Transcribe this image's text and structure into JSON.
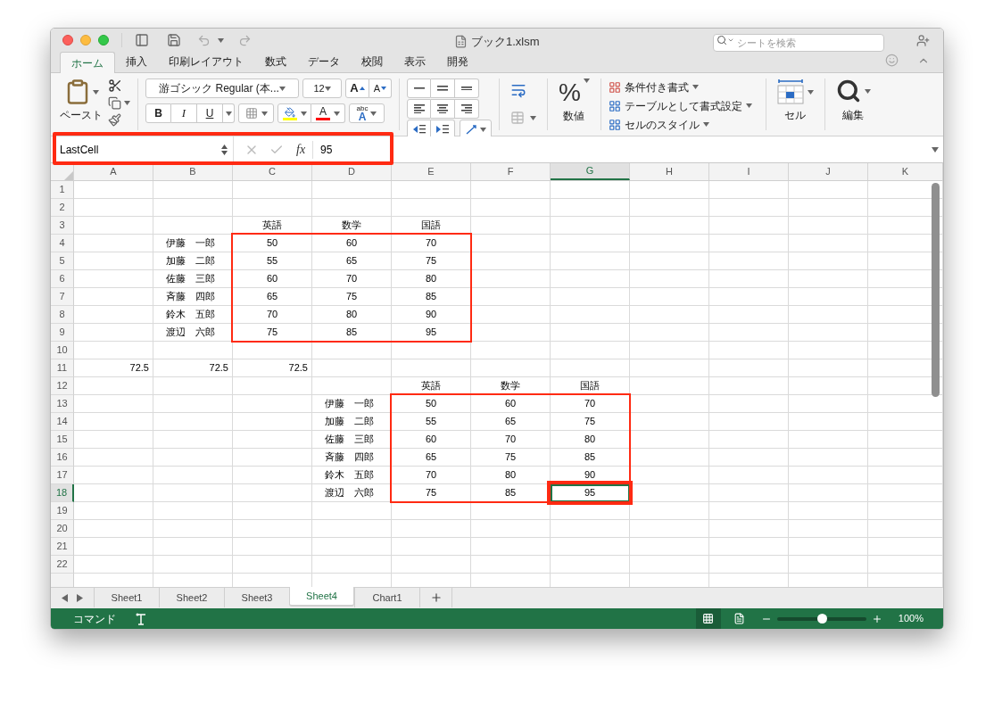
{
  "window": {
    "title": "ブック1.xlsm",
    "search_placeholder": "シートを検索"
  },
  "ribbon_tabs": [
    {
      "label": "ホーム",
      "selected": true
    },
    {
      "label": "挿入",
      "selected": false
    },
    {
      "label": "印刷レイアウト",
      "selected": false
    },
    {
      "label": "数式",
      "selected": false
    },
    {
      "label": "データ",
      "selected": false
    },
    {
      "label": "校閲",
      "selected": false
    },
    {
      "label": "表示",
      "selected": false
    },
    {
      "label": "開発",
      "selected": false
    }
  ],
  "ribbon": {
    "paste_label": "ペースト",
    "font_name": "游ゴシック Regular (本...",
    "font_size": "12",
    "grow_label": "A",
    "shrink_label": "A",
    "bold_label": "B",
    "italic_label": "I",
    "underline_label": "U",
    "font_color_label": "A",
    "wrap_small_label": "abc",
    "wrap_big_label": "A",
    "number_symbol": "%",
    "number_label": "数値",
    "style_items": [
      "条件付き書式",
      "テーブルとして書式設定",
      "セルのスタイル"
    ],
    "cells_label": "セル",
    "editing_label": "編集"
  },
  "formula_bar": {
    "name_box": "LastCell",
    "fx": "fx",
    "value": "95",
    "highlighted": true
  },
  "columns": [
    {
      "label": "A",
      "selected": false
    },
    {
      "label": "B",
      "selected": false
    },
    {
      "label": "C",
      "selected": false
    },
    {
      "label": "D",
      "selected": false
    },
    {
      "label": "E",
      "selected": false
    },
    {
      "label": "F",
      "selected": false
    },
    {
      "label": "G",
      "selected": true
    },
    {
      "label": "H",
      "selected": false
    },
    {
      "label": "I",
      "selected": false
    },
    {
      "label": "J",
      "selected": false
    },
    {
      "label": "K",
      "selected": false
    }
  ],
  "rows": [
    {
      "number": "1",
      "selected": false
    },
    {
      "number": "2",
      "selected": false
    },
    {
      "number": "3",
      "selected": false,
      "cells": [
        null,
        null,
        {
          "text": "英語",
          "kind": "center",
          "framed": false,
          "emphasized": false
        },
        {
          "text": "数学",
          "kind": "center",
          "framed": false,
          "emphasized": false
        },
        {
          "text": "国語",
          "kind": "center",
          "framed": false,
          "emphasized": false
        }
      ]
    },
    {
      "number": "4",
      "selected": false,
      "cells": [
        null,
        {
          "text": "伊藤　一郎",
          "kind": "label",
          "framed": false,
          "emphasized": false
        },
        {
          "text": "50",
          "kind": "center",
          "framed": true,
          "emphasized": false
        },
        {
          "text": "60",
          "kind": "center",
          "framed": true,
          "emphasized": false
        },
        {
          "text": "70",
          "kind": "center",
          "framed": true,
          "emphasized": false
        }
      ]
    },
    {
      "number": "5",
      "selected": false,
      "cells": [
        null,
        {
          "text": "加藤　二郎",
          "kind": "label",
          "framed": false,
          "emphasized": false
        },
        {
          "text": "55",
          "kind": "center",
          "framed": true,
          "emphasized": false
        },
        {
          "text": "65",
          "kind": "center",
          "emphasized": false
        },
        {
          "text": "75",
          "kind": "center",
          "framed": true,
          "emphasized": false
        }
      ]
    },
    {
      "number": "6",
      "selected": false,
      "cells": [
        null,
        {
          "text": "佐藤　三郎",
          "kind": "label",
          "framed": false,
          "emphasized": false
        },
        {
          "text": "60",
          "kind": "center",
          "framed": true,
          "emphasized": false
        },
        {
          "text": "70",
          "kind": "center",
          "emphasized": false
        },
        {
          "text": "80",
          "kind": "center",
          "framed": true,
          "emphasized": false
        }
      ]
    },
    {
      "number": "7",
      "selected": false,
      "cells": [
        null,
        {
          "text": "斉藤　四郎",
          "kind": "label",
          "framed": false,
          "emphasized": false
        },
        {
          "text": "65",
          "kind": "center",
          "framed": true,
          "emphasized": false
        },
        {
          "text": "75",
          "kind": "center",
          "emphasized": false
        },
        {
          "text": "85",
          "kind": "center",
          "framed": true,
          "emphasized": false
        }
      ]
    },
    {
      "number": "8",
      "selected": false,
      "cells": [
        null,
        {
          "text": "鈴木　五郎",
          "kind": "label",
          "framed": false,
          "emphasized": false
        },
        {
          "text": "70",
          "kind": "center",
          "framed": true,
          "emphasized": false
        },
        {
          "text": "80",
          "kind": "center",
          "emphasized": false
        },
        {
          "text": "90",
          "kind": "center",
          "framed": true,
          "emphasized": false
        }
      ]
    },
    {
      "number": "9",
      "selected": false,
      "cells": [
        null,
        {
          "text": "渡辺　六郎",
          "kind": "label",
          "framed": false,
          "emphasized": false
        },
        {
          "text": "75",
          "kind": "center",
          "framed": true,
          "emphasized": false
        },
        {
          "text": "85",
          "kind": "center",
          "framed": true,
          "emphasized": false
        },
        {
          "text": "95",
          "kind": "center",
          "framed": true,
          "emphasized": false
        }
      ]
    },
    {
      "number": "10",
      "selected": false
    },
    {
      "number": "11",
      "selected": false,
      "cells": [
        {
          "text": "72.5",
          "kind": "number",
          "framed": false,
          "emphasized": false
        },
        {
          "text": "72.5",
          "kind": "number",
          "framed": false,
          "emphasized": false
        },
        {
          "text": "72.5",
          "kind": "number",
          "framed": false,
          "emphasized": false
        }
      ]
    },
    {
      "number": "12",
      "selected": false,
      "cells": [
        null,
        null,
        null,
        null,
        {
          "text": "英語",
          "kind": "center",
          "framed": false,
          "emphasized": false
        },
        {
          "text": "数学",
          "kind": "center",
          "framed": false,
          "emphasized": false
        },
        {
          "text": "国語",
          "kind": "center",
          "framed": false,
          "emphasized": false
        }
      ]
    },
    {
      "number": "13",
      "selected": false,
      "cells": [
        null,
        null,
        null,
        {
          "text": "伊藤　一郎",
          "kind": "label",
          "framed": false,
          "emphasized": false
        },
        {
          "text": "50",
          "kind": "center",
          "framed": true,
          "emphasized": false
        },
        {
          "text": "60",
          "kind": "center",
          "framed": true,
          "emphasized": false
        },
        {
          "text": "70",
          "kind": "center",
          "framed": true,
          "emphasized": false
        }
      ]
    },
    {
      "number": "14",
      "selected": false,
      "cells": [
        null,
        null,
        null,
        {
          "text": "加藤　二郎",
          "kind": "label",
          "framed": false,
          "emphasized": false
        },
        {
          "text": "55",
          "kind": "center",
          "framed": true,
          "emphasized": false
        },
        {
          "text": "65",
          "kind": "center",
          "emphasized": false
        },
        {
          "text": "75",
          "kind": "center",
          "framed": true,
          "emphasized": false
        }
      ]
    },
    {
      "number": "15",
      "selected": false,
      "cells": [
        null,
        null,
        null,
        {
          "text": "佐藤　三郎",
          "kind": "label",
          "framed": false,
          "emphasized": false
        },
        {
          "text": "60",
          "kind": "center",
          "framed": true,
          "emphasized": false
        },
        {
          "text": "70",
          "kind": "center",
          "emphasized": false
        },
        {
          "text": "80",
          "kind": "center",
          "framed": true,
          "emphasized": false
        }
      ]
    },
    {
      "number": "16",
      "selected": false,
      "cells": [
        null,
        null,
        null,
        {
          "text": "斉藤　四郎",
          "kind": "label",
          "framed": false,
          "emphasized": false
        },
        {
          "text": "65",
          "kind": "center",
          "framed": true,
          "emphasized": false
        },
        {
          "text": "75",
          "kind": "center",
          "emphasized": false
        },
        {
          "text": "85",
          "kind": "center",
          "framed": true,
          "emphasized": false
        }
      ]
    },
    {
      "number": "17",
      "selected": false,
      "cells": [
        null,
        null,
        null,
        {
          "text": "鈴木　五郎",
          "kind": "label",
          "framed": false,
          "emphasized": false
        },
        {
          "text": "70",
          "kind": "center",
          "framed": true,
          "emphasized": false
        },
        {
          "text": "80",
          "kind": "center",
          "emphasized": false
        },
        {
          "text": "90",
          "kind": "center",
          "framed": true,
          "emphasized": false
        }
      ]
    },
    {
      "number": "18",
      "selected": true,
      "cells": [
        null,
        null,
        null,
        {
          "text": "渡辺　六郎",
          "kind": "label",
          "framed": false,
          "emphasized": false
        },
        {
          "text": "75",
          "kind": "center",
          "framed": true,
          "emphasized": false
        },
        {
          "text": "85",
          "kind": "center",
          "framed": true,
          "emphasized": false
        },
        {
          "text": "95",
          "kind": "center",
          "framed": true,
          "emphasized": true
        }
      ]
    },
    {
      "number": "19",
      "selected": false
    },
    {
      "number": "20",
      "selected": false
    },
    {
      "number": "21",
      "selected": false
    },
    {
      "number": "22",
      "selected": false
    }
  ],
  "sheet_tabs": [
    {
      "label": "Sheet1",
      "selected": false
    },
    {
      "label": "Sheet2",
      "selected": false
    },
    {
      "label": "Sheet3",
      "selected": false
    },
    {
      "label": "Sheet4",
      "selected": true
    },
    {
      "label": "Chart1",
      "selected": false
    }
  ],
  "status_bar": {
    "mode": "コマンド",
    "zoom": "100%",
    "zoom_level": {
      "level": 0.5
    }
  }
}
